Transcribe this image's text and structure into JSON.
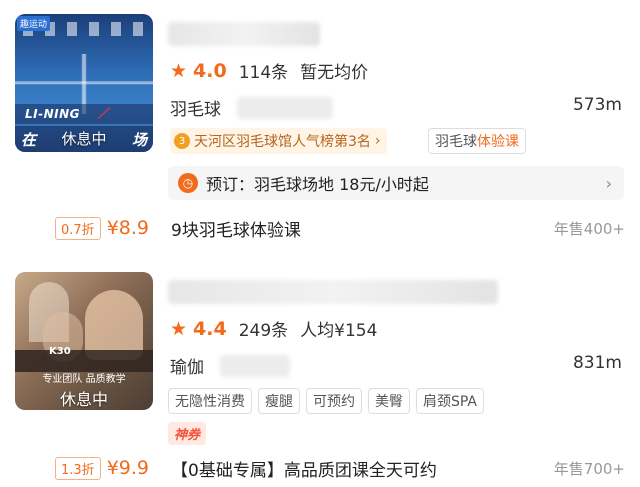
{
  "listings": [
    {
      "thumb": {
        "corner_tag": "趣运动",
        "brand": "LI-NING",
        "strip_left": "在",
        "strip_right": "场",
        "status": "休息中"
      },
      "rating": {
        "score": "4.0",
        "reviews": "114条",
        "price": "暂无均价"
      },
      "category": "羽毛球",
      "distance": "573m",
      "rank_badge": "天河区羽毛球馆人气榜第3名",
      "trial_tag_prefix": "羽毛球",
      "trial_tag_accent": "体验课",
      "booking": {
        "text": "预订：羽毛球场地 18元/小时起"
      },
      "deal": {
        "discount": "0.7折",
        "price": "¥8.9",
        "title": "9块羽毛球体验课",
        "sold": "年售400+"
      }
    },
    {
      "thumb": {
        "brand": "K30",
        "slogan": "专业团队 品质教学",
        "status": "休息中"
      },
      "rating": {
        "score": "4.4",
        "reviews": "249条",
        "price": "人均¥154"
      },
      "category": "瑜伽",
      "distance": "831m",
      "tags": [
        "无隐性消费",
        "瘦腿",
        "可预约",
        "美臀",
        "肩颈SPA"
      ],
      "coupon": "神券",
      "deal": {
        "discount": "1.3折",
        "price": "¥9.9",
        "title": "【0基础专属】高品质团课全天可约",
        "sold": "年售700+"
      }
    }
  ],
  "icons": {
    "star": "star-icon",
    "medal": "medal-icon",
    "clock": "clock-icon",
    "arrow": "chevron-right-icon"
  },
  "colors": {
    "accent": "#f26a1b",
    "muted": "#999999"
  }
}
